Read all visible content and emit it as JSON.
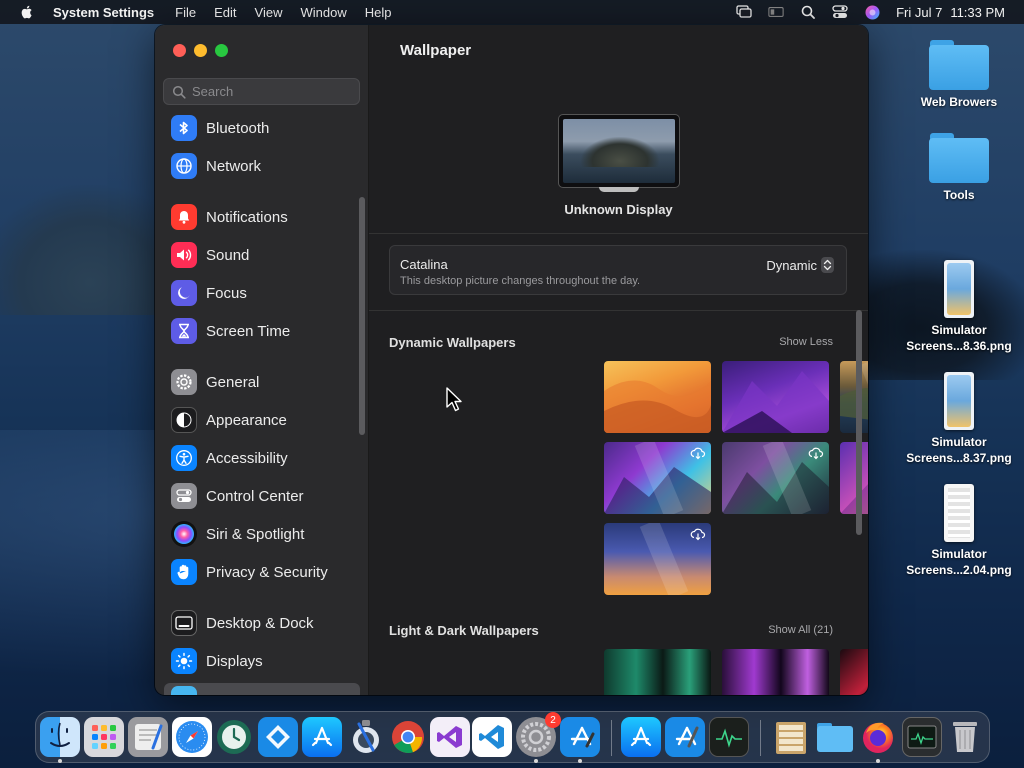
{
  "menubar": {
    "app_name": "System Settings",
    "menus": [
      "File",
      "Edit",
      "View",
      "Window",
      "Help"
    ],
    "clock_day": "Fri Jul 7",
    "clock_time": "11:33 PM",
    "tray_icons": [
      "screen-mirroring-icon",
      "display-icon",
      "search-icon",
      "control-center-icon",
      "siri-icon"
    ]
  },
  "window": {
    "search_placeholder": "Search",
    "sidebar": {
      "items": [
        {
          "label": "Bluetooth",
          "icon": "bluetooth-icon",
          "color": "#2f7cf6"
        },
        {
          "label": "Network",
          "icon": "globe-icon",
          "color": "#2f7cf6"
        },
        {
          "label": "Notifications",
          "icon": "bell-icon",
          "color": "#ff3b30"
        },
        {
          "label": "Sound",
          "icon": "speaker-icon",
          "color": "#ff2d55"
        },
        {
          "label": "Focus",
          "icon": "moon-icon",
          "color": "#5e5ce6"
        },
        {
          "label": "Screen Time",
          "icon": "hourglass-icon",
          "color": "#5e5ce6"
        },
        {
          "label": "General",
          "icon": "gear-icon",
          "color": "#8e8e93"
        },
        {
          "label": "Appearance",
          "icon": "appearance-icon",
          "color": "#1c1c1e"
        },
        {
          "label": "Accessibility",
          "icon": "accessibility-icon",
          "color": "#0a84ff"
        },
        {
          "label": "Control Center",
          "icon": "control-center-icon",
          "color": "#8e8e93"
        },
        {
          "label": "Siri & Spotlight",
          "icon": "siri-icon",
          "color": "#b04fe0"
        },
        {
          "label": "Privacy & Security",
          "icon": "hand-icon",
          "color": "#0a84ff"
        },
        {
          "label": "Desktop & Dock",
          "icon": "dock-icon",
          "color": "#1c1c1e"
        },
        {
          "label": "Displays",
          "icon": "sun-icon",
          "color": "#0a84ff"
        }
      ]
    },
    "content": {
      "title": "Wallpaper",
      "display_name": "Unknown Display",
      "wallpaper": {
        "name": "Catalina",
        "description": "This desktop picture changes throughout the day.",
        "mode": "Dynamic"
      },
      "dynamic_section": {
        "title": "Dynamic Wallpapers",
        "link": "Show Less"
      },
      "light_dark_section": {
        "title": "Light & Dark Wallpapers",
        "link": "Show All (21)"
      }
    }
  },
  "desktop": {
    "icons": [
      {
        "label": "Web Browers"
      },
      {
        "label": "Tools"
      },
      {
        "label_line1": "Simulator",
        "label_line2": "Screens...8.36.png"
      },
      {
        "label_line1": "Simulator",
        "label_line2": "Screens...8.37.png"
      },
      {
        "label_line1": "Simulator",
        "label_line2": "Screens...2.04.png"
      }
    ]
  },
  "dock": {
    "badge_count": "2",
    "apps": [
      "Finder",
      "Launchpad",
      "Script Editor",
      "Safari",
      "Time Machine",
      "Simulator",
      "App Store",
      "Instruments",
      "Chrome",
      "Visual Studio",
      "VS Code",
      "System Settings",
      "Xcode Tools",
      "App Store",
      "Xcode",
      "Activity Monitor",
      "Archive",
      "Downloads",
      "Firefox",
      "Console",
      "Trash"
    ]
  },
  "colors": {
    "accent": "#2f6fd9",
    "window_bg": "#1f1f21",
    "sidebar_bg": "#2a2a2c"
  }
}
